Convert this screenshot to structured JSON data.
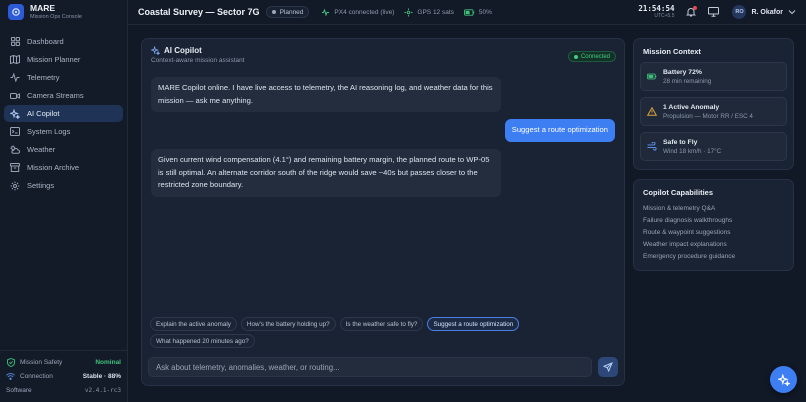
{
  "brand": {
    "title": "MARE",
    "subtitle": "Mission Ops Console"
  },
  "nav": [
    {
      "label": "Dashboard",
      "icon": "dashboard-icon",
      "active": false
    },
    {
      "label": "Mission Planner",
      "icon": "map-icon",
      "active": false
    },
    {
      "label": "Telemetry",
      "icon": "pulse-icon",
      "active": false
    },
    {
      "label": "Camera Streams",
      "icon": "camera-icon",
      "active": false
    },
    {
      "label": "AI Copilot",
      "icon": "sparkles-icon",
      "active": true
    },
    {
      "label": "System Logs",
      "icon": "terminal-icon",
      "active": false
    },
    {
      "label": "Weather",
      "icon": "cloud-icon",
      "active": false
    },
    {
      "label": "Mission Archive",
      "icon": "archive-icon",
      "active": false
    },
    {
      "label": "Settings",
      "icon": "gear-icon",
      "active": false
    }
  ],
  "footer": {
    "safety_label": "Mission Safety",
    "safety_value": "Nominal",
    "connection_label": "Connection",
    "connection_value": "Stable · 88%",
    "software_label": "Software",
    "software_value": "v2.4.1-rc3"
  },
  "topbar": {
    "mission": "Coastal Survey — Sector 7G",
    "status": "Planned",
    "px4": "PX4 connected (live)",
    "gps": "GPS 12 sats",
    "battery": "50%",
    "time": "21:54:54",
    "tz": "UTC+5.5",
    "user_initials": "RO",
    "user_name": "R. Okafor"
  },
  "chat": {
    "title": "AI Copilot",
    "subtitle": "Context-aware mission assistant",
    "status": "Connected",
    "messages": [
      {
        "role": "assistant",
        "text": "MARE Copilot online. I have live access to telemetry, the AI reasoning log, and weather data for this mission — ask me anything."
      },
      {
        "role": "user",
        "text": "Suggest a route optimization"
      },
      {
        "role": "assistant",
        "text": "Given current wind compensation (4.1°) and remaining battery margin, the planned route to WP-05 is still optimal. An alternate corridor south of the ridge would save ~40s but passes closer to the restricted zone boundary."
      }
    ],
    "suggestions": [
      "Explain the active anomaly",
      "How's the battery holding up?",
      "Is the weather safe to fly?",
      "Suggest a route optimization",
      "What happened 20 minutes ago?"
    ],
    "input_placeholder": "Ask about telemetry, anomalies, weather, or routing..."
  },
  "context": {
    "title": "Mission Context",
    "items": [
      {
        "title": "Battery 72%",
        "sub": "28 min remaining",
        "icon": "battery-icon",
        "color": "#3fc37a"
      },
      {
        "title": "1 Active Anomaly",
        "sub": "Propulsion — Motor RR / ESC 4",
        "icon": "warning-icon",
        "color": "#e3a33b"
      },
      {
        "title": "Safe to Fly",
        "sub": "Wind 18 km/h · 17°C",
        "icon": "wind-icon",
        "color": "#5b8fe8"
      }
    ]
  },
  "capabilities": {
    "title": "Copilot Capabilities",
    "items": [
      "Mission & telemetry Q&A",
      "Failure diagnosis walkthroughs",
      "Route & waypoint suggestions",
      "Weather impact explanations",
      "Emergency procedure guidance"
    ]
  },
  "colors": {
    "accent": "#3d7ef2",
    "ok": "#3fc37a",
    "warn": "#e3a33b",
    "danger": "#e5484d"
  }
}
